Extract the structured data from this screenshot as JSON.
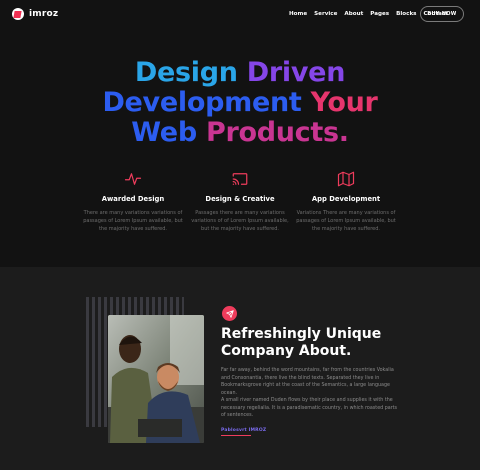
{
  "brand": {
    "name": "imroz"
  },
  "nav": {
    "items": [
      "Home",
      "Service",
      "About",
      "Pages",
      "Blocks",
      "Contact"
    ],
    "cta": "BUY NOW"
  },
  "hero": {
    "line1": [
      "Design",
      "Driven"
    ],
    "line2": [
      "Development",
      "Your"
    ],
    "line3": [
      "Web",
      "Products."
    ]
  },
  "features": [
    {
      "icon": "pulse-icon",
      "title": "Awarded Design",
      "desc": "There are many variations variations of passages of Lorem Ipsum available, but the majority have suffered."
    },
    {
      "icon": "cast-icon",
      "title": "Design & Creative",
      "desc": "Passages there are many variations variations of of Lorem Ipsum available, but the majority have suffered."
    },
    {
      "icon": "map-icon",
      "title": "App Development",
      "desc": "Variations There are many variations of passages of Lorem Ipsum available, but the majority have suffered."
    }
  ],
  "about": {
    "badge_icon": "send-icon",
    "title_line1": "Refreshingly Unique",
    "title_line2": "Company About.",
    "para1": "Far far away, behind the word mountains, far from the countries Vokalia and Consonantia, there live the blind texts. Separated they live in Bookmarksgrove right at the coast of the Semantics, a large language ocean.",
    "para2": "A small river named Duden flows by their place and supplies it with the necessary regelialia. It is a paradisematic country, in which roasted parts of sentences.",
    "signature": "Pablosvrt IMROZ"
  },
  "colors": {
    "accent": "#ef3c5c",
    "background": "#121212",
    "section": "#1c1c1c"
  }
}
